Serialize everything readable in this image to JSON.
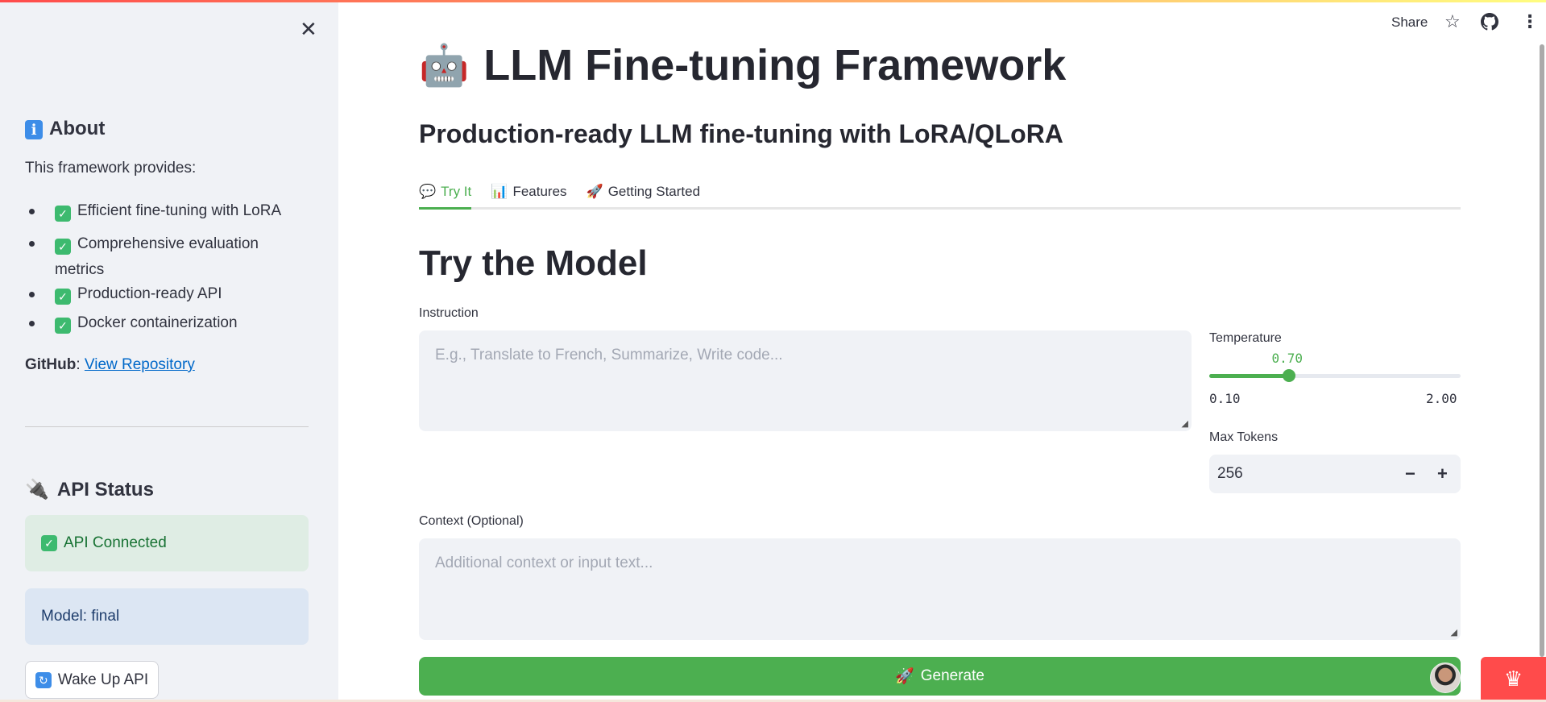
{
  "header": {
    "share": "Share",
    "star_icon": "star-icon",
    "github_icon": "github-icon",
    "menu_icon": "more-vertical-icon"
  },
  "sidebar": {
    "close": "✕",
    "about_icon": "ℹ",
    "about_title": "About",
    "intro": "This framework provides:",
    "features": [
      "Efficient fine-tuning with LoRA",
      "Comprehensive evaluation metrics",
      "Production-ready API",
      "Docker containerization"
    ],
    "github_label": "GitHub",
    "github_link": "View Repository",
    "api_status_title": "API Status",
    "api_connected": "API Connected",
    "model": "Model: final",
    "wake_button": "Wake Up API"
  },
  "main": {
    "title": "LLM Fine-tuning Framework",
    "subtitle": "Production-ready LLM fine-tuning with LoRA/QLoRA",
    "tabs": [
      {
        "icon": "💬",
        "label": "Try It"
      },
      {
        "icon": "📊",
        "label": "Features"
      },
      {
        "icon": "🚀",
        "label": "Getting Started"
      }
    ],
    "section_title": "Try the Model",
    "instruction_label": "Instruction",
    "instruction_placeholder": "E.g., Translate to French, Summarize, Write code...",
    "temperature_label": "Temperature",
    "temperature_value": "0.70",
    "temperature_min": "0.10",
    "temperature_max": "2.00",
    "temperature_fraction": 0.3158,
    "max_tokens_label": "Max Tokens",
    "max_tokens_value": "256",
    "minus": "−",
    "plus": "+",
    "context_label": "Context (Optional)",
    "context_placeholder": "Additional context or input text...",
    "generate_button": "Generate"
  },
  "colors": {
    "accent": "#4caf50",
    "brand": "#ff4b4b"
  }
}
